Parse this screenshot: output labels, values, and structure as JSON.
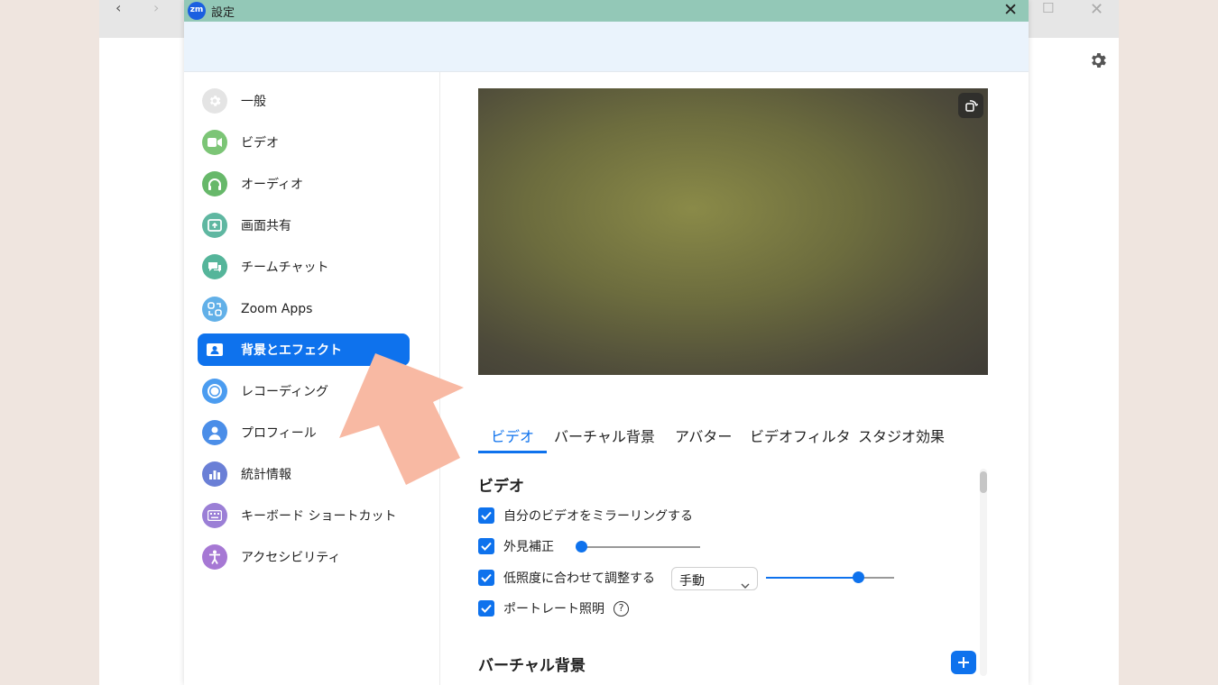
{
  "background_app": {
    "nav_back": "‹",
    "nav_forward": "›",
    "maximize": "☐",
    "close": "✕",
    "gear_icon": "gear-icon"
  },
  "dialog": {
    "logo_text": "zm",
    "title": "設定",
    "close": "✕"
  },
  "sidebar": {
    "items": [
      {
        "label": "一般",
        "icon": "gear-icon",
        "color": "#c9c9c9"
      },
      {
        "label": "ビデオ",
        "icon": "video-camera-icon",
        "color": "#7cc576"
      },
      {
        "label": "オーディオ",
        "icon": "headphones-icon",
        "color": "#67b86a"
      },
      {
        "label": "画面共有",
        "icon": "share-screen-icon",
        "color": "#5fb7a1"
      },
      {
        "label": "チームチャット",
        "icon": "chat-icon",
        "color": "#55b59a"
      },
      {
        "label": "Zoom Apps",
        "icon": "apps-icon",
        "color": "#62b0e8"
      },
      {
        "label": "背景とエフェクト",
        "icon": "background-icon",
        "color": "#ffffff"
      },
      {
        "label": "レコーディング",
        "icon": "record-icon",
        "color": "#4b9cf0"
      },
      {
        "label": "プロフィール",
        "icon": "profile-icon",
        "color": "#4b8ee8"
      },
      {
        "label": "統計情報",
        "icon": "statistics-icon",
        "color": "#6a7fd6"
      },
      {
        "label": "キーボード ショートカット",
        "icon": "keyboard-icon",
        "color": "#9b7fd6"
      },
      {
        "label": "アクセシビリティ",
        "icon": "accessibility-icon",
        "color": "#a678d4"
      }
    ],
    "active_index": 6,
    "active_color": "#0e72ed"
  },
  "preview": {
    "rotate_icon": "rotate-camera-icon"
  },
  "tabs": [
    {
      "label": "ビデオ",
      "active": true
    },
    {
      "label": "バーチャル背景",
      "active": false
    },
    {
      "label": "アバター",
      "active": false
    },
    {
      "label": "ビデオフィルタ",
      "active": false
    },
    {
      "label": "スタジオ効果",
      "active": false
    }
  ],
  "video_section": {
    "title": "ビデオ",
    "options": [
      {
        "label": "自分のビデオをミラーリングする",
        "checked": true
      },
      {
        "label": "外見補正",
        "checked": true,
        "slider_value": 0.0
      },
      {
        "label": "低照度に合わせて調整する",
        "checked": true,
        "select_value": "手動",
        "slider_value": 0.72
      },
      {
        "label": "ポートレート照明",
        "checked": true,
        "help": "?"
      }
    ]
  },
  "virtual_bg_section": {
    "title": "バーチャル背景",
    "add_label": "+"
  },
  "annotation": {
    "arrow_color": "#f8b9a3"
  }
}
